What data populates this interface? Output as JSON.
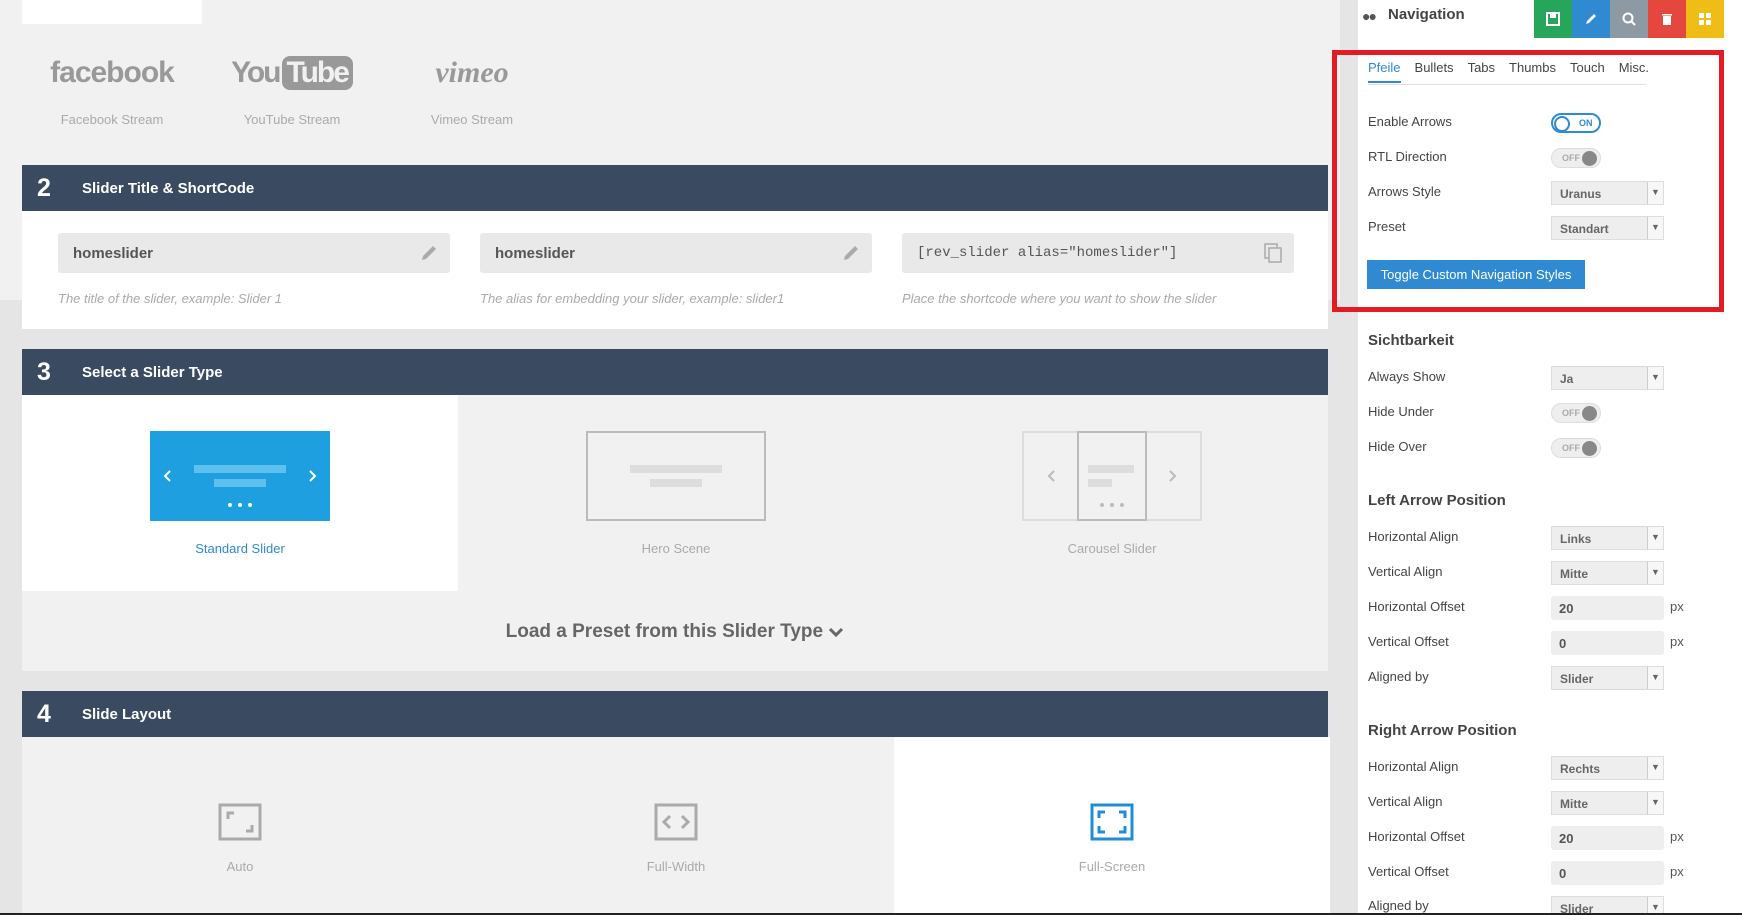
{
  "streams": [
    {
      "logo": "facebook",
      "label": "Facebook Stream"
    },
    {
      "logo_you": "You",
      "logo_tube": "Tube",
      "label": "YouTube Stream"
    },
    {
      "logo": "vimeo",
      "label": "Vimeo Stream"
    }
  ],
  "section2": {
    "number": "2",
    "title": "Slider Title & ShortCode",
    "title_value": "homeslider",
    "alias_value": "homeslider",
    "shortcode_value": "[rev_slider alias=\"homeslider\"]",
    "title_hint": "The title of the slider, example: Slider 1",
    "alias_hint": "The alias for embedding your slider, example: slider1",
    "shortcode_hint": "Place the shortcode where you want to show the slider"
  },
  "section3": {
    "number": "3",
    "title": "Select a Slider Type",
    "types": [
      "Standard Slider",
      "Hero Scene",
      "Carousel Slider"
    ],
    "load_preset": "Load a Preset from this Slider Type"
  },
  "section4": {
    "number": "4",
    "title": "Slide Layout",
    "layouts": [
      "Auto",
      "Full-Width",
      "Full-Screen"
    ]
  },
  "sidebar": {
    "title": "Navigation",
    "toolbar_colors": {
      "save": "#27a65b",
      "edit": "#2f8ad2",
      "search": "#8d9aa3",
      "delete": "#e5473e",
      "grid": "#f0bd16"
    },
    "tabs": [
      "Pfeile",
      "Bullets",
      "Tabs",
      "Thumbs",
      "Touch",
      "Misc."
    ],
    "enable_arrows": {
      "label": "Enable Arrows",
      "state": "ON"
    },
    "rtl_direction": {
      "label": "RTL Direction",
      "state": "OFF"
    },
    "arrows_style": {
      "label": "Arrows Style",
      "value": "Uranus"
    },
    "preset": {
      "label": "Preset",
      "value": "Standart"
    },
    "toggle_button": "Toggle Custom Navigation Styles",
    "visibility": {
      "title": "Sichtbarkeit",
      "always_show": {
        "label": "Always Show",
        "value": "Ja"
      },
      "hide_under": {
        "label": "Hide Under",
        "state": "OFF"
      },
      "hide_over": {
        "label": "Hide Over",
        "state": "OFF"
      }
    },
    "left_arrow": {
      "title": "Left Arrow Position",
      "h_align": {
        "label": "Horizontal Align",
        "value": "Links"
      },
      "v_align": {
        "label": "Vertical Align",
        "value": "Mitte"
      },
      "h_offset": {
        "label": "Horizontal Offset",
        "value": "20",
        "unit": "px"
      },
      "v_offset": {
        "label": "Vertical Offset",
        "value": "0",
        "unit": "px"
      },
      "aligned_by": {
        "label": "Aligned by",
        "value": "Slider"
      }
    },
    "right_arrow": {
      "title": "Right Arrow Position",
      "h_align": {
        "label": "Horizontal Align",
        "value": "Rechts"
      },
      "v_align": {
        "label": "Vertical Align",
        "value": "Mitte"
      },
      "h_offset": {
        "label": "Horizontal Offset",
        "value": "20",
        "unit": "px"
      },
      "v_offset": {
        "label": "Vertical Offset",
        "value": "0",
        "unit": "px"
      },
      "aligned_by": {
        "label": "Aligned by",
        "value": "Slider"
      }
    }
  }
}
